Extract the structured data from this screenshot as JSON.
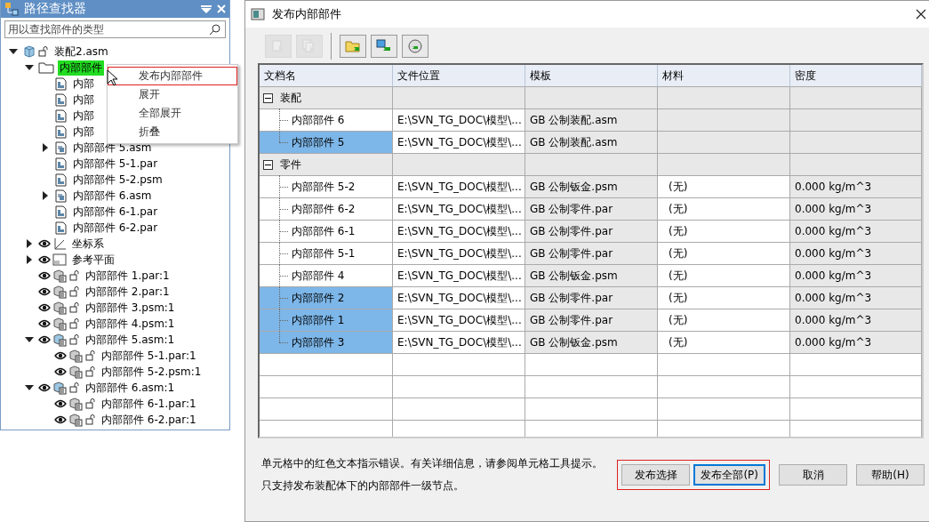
{
  "pathfinder": {
    "title": "路径查找器",
    "search": {
      "placeholder": "用以查找部件的类型"
    },
    "tree": [
      {
        "label": "装配2.asm",
        "kind": "root",
        "expanded": true,
        "selected": false,
        "children": [
          {
            "label": "内部部件",
            "kind": "folder",
            "expanded": true,
            "selected": true,
            "children": [
              {
                "label": "内部",
                "kind": "doc-part",
                "selected": false
              },
              {
                "label": "内部",
                "kind": "doc-part",
                "selected": false
              },
              {
                "label": "内部",
                "kind": "doc-part",
                "selected": false
              },
              {
                "label": "内部",
                "kind": "doc-part",
                "selected": false
              },
              {
                "label": "内部部件 5.asm",
                "kind": "doc-asm",
                "expanded": false,
                "selected": false
              },
              {
                "label": "内部部件 5-1.par",
                "kind": "doc-part",
                "selected": false
              },
              {
                "label": "内部部件 5-2.psm",
                "kind": "doc-part",
                "selected": false
              },
              {
                "label": "内部部件 6.asm",
                "kind": "doc-asm",
                "expanded": false,
                "selected": false
              },
              {
                "label": "内部部件 6-1.par",
                "kind": "doc-part",
                "selected": false
              },
              {
                "label": "内部部件 6-2.par",
                "kind": "doc-part",
                "selected": false
              }
            ]
          },
          {
            "label": "坐标系",
            "kind": "coord",
            "expanded": false,
            "selected": false
          },
          {
            "label": "参考平面",
            "kind": "plane",
            "expanded": false,
            "selected": false
          },
          {
            "label": "内部部件 1.par:1",
            "kind": "occ-part",
            "selected": false
          },
          {
            "label": "内部部件 2.par:1",
            "kind": "occ-part",
            "selected": false
          },
          {
            "label": "内部部件 3.psm:1",
            "kind": "occ-part",
            "selected": false
          },
          {
            "label": "内部部件 4.psm:1",
            "kind": "occ-part",
            "selected": false
          },
          {
            "label": "内部部件 5.asm:1",
            "kind": "occ-asm",
            "expanded": true,
            "selected": false,
            "children": [
              {
                "label": "内部部件 5-1.par:1",
                "kind": "occ-part",
                "selected": false
              },
              {
                "label": "内部部件 5-2.psm:1",
                "kind": "occ-part",
                "selected": false
              }
            ]
          },
          {
            "label": "内部部件 6.asm:1",
            "kind": "occ-asm",
            "expanded": true,
            "selected": false,
            "children": [
              {
                "label": "内部部件 6-1.par:1",
                "kind": "occ-part",
                "selected": false
              },
              {
                "label": "内部部件 6-2.par:1",
                "kind": "occ-part",
                "selected": false
              }
            ]
          }
        ]
      }
    ],
    "context_menu": [
      {
        "label": "发布内部部件",
        "outlined": true
      },
      {
        "label": "展开",
        "outlined": false
      },
      {
        "label": "全部展开",
        "outlined": false
      },
      {
        "label": "折叠",
        "outlined": false
      }
    ]
  },
  "dialog": {
    "title": "发布内部部件",
    "toolbar": [
      {
        "kind": "select",
        "disabled": true
      },
      {
        "kind": "select-all",
        "disabled": true
      },
      {
        "kind": "folder",
        "disabled": false
      },
      {
        "kind": "swap",
        "disabled": false
      },
      {
        "kind": "refresh",
        "disabled": false
      }
    ],
    "columns": [
      "文档名",
      "文件位置",
      "模板",
      "材料",
      "密度"
    ],
    "groups": [
      {
        "label": "装配",
        "expanded": true,
        "rows": [
          {
            "name": "内部部件 6",
            "location": "E:\\SVN_TG_DOC\\模型\\...",
            "template": "GB 公制装配.asm",
            "selected": false
          },
          {
            "name": "内部部件 5",
            "location": "E:\\SVN_TG_DOC\\模型\\...",
            "template": "GB 公制装配.asm",
            "selected": true
          }
        ]
      },
      {
        "label": "零件",
        "expanded": true,
        "rows": [
          {
            "name": "内部部件 5-2",
            "location": "E:\\SVN_TG_DOC\\模型\\...",
            "template": "GB 公制钣金.psm",
            "material": "(无)",
            "density": "0.000 kg/m^3",
            "selected": false
          },
          {
            "name": "内部部件 6-2",
            "location": "E:\\SVN_TG_DOC\\模型\\...",
            "template": "GB 公制零件.par",
            "material": "(无)",
            "density": "0.000 kg/m^3",
            "selected": false
          },
          {
            "name": "内部部件 6-1",
            "location": "E:\\SVN_TG_DOC\\模型\\...",
            "template": "GB 公制零件.par",
            "material": "(无)",
            "density": "0.000 kg/m^3",
            "selected": false
          },
          {
            "name": "内部部件 5-1",
            "location": "E:\\SVN_TG_DOC\\模型\\...",
            "template": "GB 公制零件.par",
            "material": "(无)",
            "density": "0.000 kg/m^3",
            "selected": false
          },
          {
            "name": "内部部件 4",
            "location": "E:\\SVN_TG_DOC\\模型\\...",
            "template": "GB 公制钣金.psm",
            "material": "(无)",
            "density": "0.000 kg/m^3",
            "selected": false
          },
          {
            "name": "内部部件 2",
            "location": "E:\\SVN_TG_DOC\\模型\\...",
            "template": "GB 公制零件.par",
            "material": "(无)",
            "density": "0.000 kg/m^3",
            "selected": true
          },
          {
            "name": "内部部件 1",
            "location": "E:\\SVN_TG_DOC\\模型\\...",
            "template": "GB 公制零件.par",
            "material": "(无)",
            "density": "0.000 kg/m^3",
            "selected": true
          },
          {
            "name": "内部部件 3",
            "location": "E:\\SVN_TG_DOC\\模型\\...",
            "template": "GB 公制钣金.psm",
            "material": "(无)",
            "density": "0.000 kg/m^3",
            "selected": true
          }
        ]
      }
    ],
    "notes": [
      "单元格中的红色文本指示错误。有关详细信息，请参阅单元格工具提示。",
      "只支持发布装配体下的内部部件一级节点。"
    ],
    "buttons": [
      {
        "label": "发布选择",
        "focused": false,
        "outlined": true
      },
      {
        "label": "发布全部(P)",
        "focused": true,
        "outlined": true
      },
      {
        "label": "取消",
        "focused": false,
        "outlined": false
      },
      {
        "label": "帮助(H)",
        "focused": false,
        "outlined": false
      }
    ]
  }
}
